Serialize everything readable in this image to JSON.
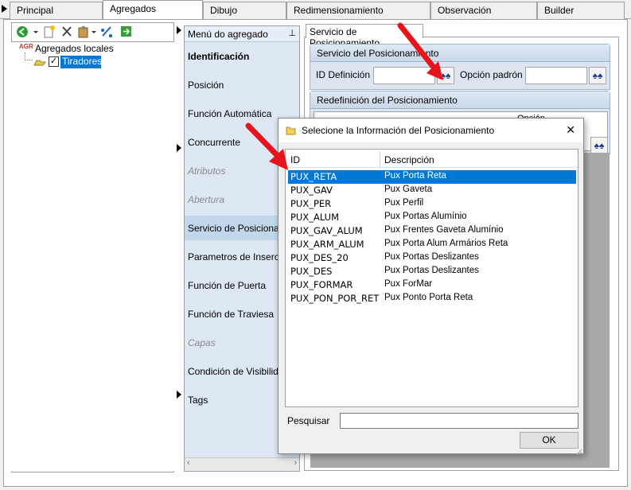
{
  "tabs": [
    "Principal",
    "Agregados",
    "Dibujo",
    "Redimensionamiento",
    "Observación",
    "Builder"
  ],
  "tree": {
    "root": "Agregados locales",
    "root_icon_text": "AGR",
    "child": "Tiradores"
  },
  "menu": {
    "header": "Menú do agregado",
    "items": [
      {
        "label": "Identificación",
        "state": "bold"
      },
      {
        "label": "Posición",
        "state": "normal"
      },
      {
        "label": "Función Automática",
        "state": "normal"
      },
      {
        "label": "Concurrente",
        "state": "normal"
      },
      {
        "label": "Atributos",
        "state": "disabled"
      },
      {
        "label": "Abertura",
        "state": "disabled"
      },
      {
        "label": "Servicio de Posicionam",
        "state": "selected"
      },
      {
        "label": "Parametros de Inserciói",
        "state": "normal"
      },
      {
        "label": "Función de Puerta",
        "state": "normal"
      },
      {
        "label": "Función de Traviesa",
        "state": "normal"
      },
      {
        "label": "Capas",
        "state": "disabled"
      },
      {
        "label": "Condición de Visibilidad",
        "state": "normal"
      },
      {
        "label": "Tags",
        "state": "normal"
      }
    ]
  },
  "right": {
    "tab": "Servicio de Posicionamiento",
    "service_group": "Servicio del Posicionamiento",
    "id_label": "ID Definición",
    "default_label": "Opción padrón",
    "redef_group": "Redefinición del Posicionamiento",
    "partial_header": "Opción"
  },
  "modal": {
    "title": "Selecione la Información del Posicionamiento",
    "col_id": "ID",
    "col_desc": "Descripción",
    "rows": [
      {
        "id": "PUX_RETA",
        "desc": "Pux Porta Reta"
      },
      {
        "id": "PUX_GAV",
        "desc": "Pux Gaveta"
      },
      {
        "id": "PUX_PER",
        "desc": "Pux Perfil"
      },
      {
        "id": "PUX_ALUM",
        "desc": "Pux Portas Alumínio"
      },
      {
        "id": "PUX_GAV_ALUM",
        "desc": "Pux Frentes Gaveta Alumínio"
      },
      {
        "id": "PUX_ARM_ALUM",
        "desc": "Pux Porta Alum Armários Reta"
      },
      {
        "id": "PUX_DES_20",
        "desc": "Pux Portas Deslizantes"
      },
      {
        "id": "PUX_DES",
        "desc": "Pux Portas Deslizantes"
      },
      {
        "id": "PUX_FORMAR",
        "desc": "Pux ForMar"
      },
      {
        "id": "PUX_PON_POR_RET",
        "desc": "Pux Ponto Porta Reta"
      }
    ],
    "search_label": "Pesquisar",
    "search_value": "",
    "ok_label": "OK",
    "close_glyph": "✕"
  },
  "colors": {
    "accent": "#0078d7",
    "arrow": "#e8141b",
    "menu_bg": "#dde8f3"
  }
}
